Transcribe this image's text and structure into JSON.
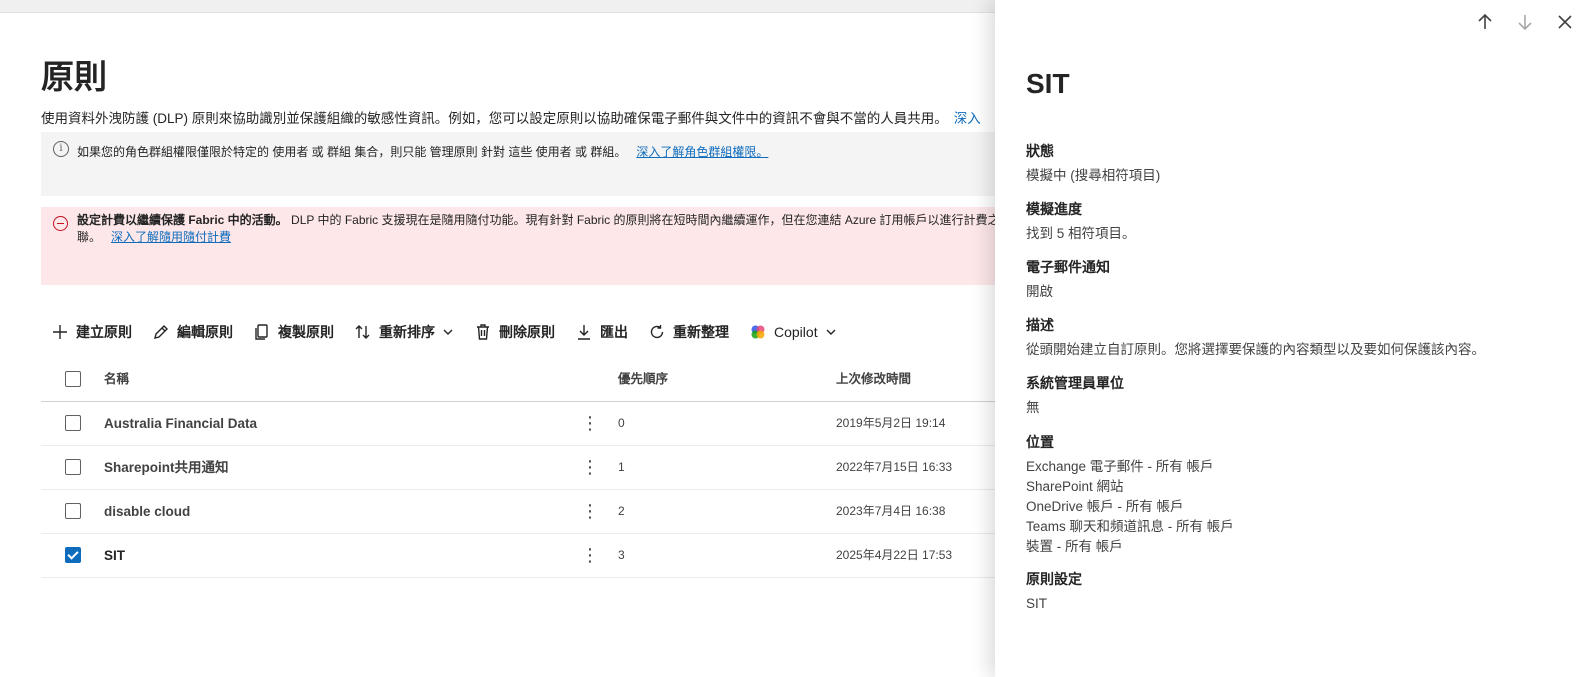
{
  "page": {
    "title": "原則",
    "intro": "使用資料外洩防護 (DLP) 原則來協助識別並保護組織的敏感性資訊。例如，您可以設定原則以協助確保電子郵件與文件中的資訊不會與不當的人員共用。",
    "intro_link": "深入"
  },
  "info_banner": {
    "text": "如果您的角色群組權限僅限於特定的 使用者 或 群組 集合，則只能 管理原則 針對 這些 使用者 或 群組。",
    "link": "深入了解角色群組權限。"
  },
  "error_banner": {
    "title": "設定計費以繼續保護 Fabric 中的活動。",
    "text": "DLP 中的 Fabric 支援現在是隨用隨付功能。現有針對 Fabric 的原則將在短時間內繼續運作，但在您連結 Azure 訂用帳戶以進行計費之前",
    "line2": "聯。",
    "link": "深入了解隨用隨付計費"
  },
  "toolbar": {
    "create": "建立原則",
    "edit": "編輯原則",
    "copy": "複製原則",
    "reorder": "重新排序",
    "delete": "刪除原則",
    "export": "匯出",
    "refresh": "重新整理",
    "copilot": "Copilot"
  },
  "table": {
    "headers": {
      "name": "名稱",
      "priority": "優先順序",
      "modified": "上次修改時間"
    },
    "rows": [
      {
        "name": "Australia Financial Data",
        "priority": "0",
        "modified": "2019年5月2日 19:14",
        "selected": false
      },
      {
        "name": "Sharepoint共用通知",
        "priority": "1",
        "modified": "2022年7月15日 16:33",
        "selected": false
      },
      {
        "name": "disable cloud",
        "priority": "2",
        "modified": "2023年7月4日 16:38",
        "selected": false
      },
      {
        "name": "SIT",
        "priority": "3",
        "modified": "2025年4月22日 17:53",
        "selected": true
      }
    ]
  },
  "panel": {
    "title": "SIT",
    "status": {
      "label": "狀態",
      "value": "模擬中 (搜尋相符項目)"
    },
    "sim_progress": {
      "label": "模擬進度",
      "value": "找到 5 相符項目。"
    },
    "email_notify": {
      "label": "電子郵件通知",
      "value": "開啟"
    },
    "description": {
      "label": "描述",
      "value": "從頭開始建立自訂原則。您將選擇要保護的內容類型以及要如何保護該內容。"
    },
    "admin_units": {
      "label": "系統管理員單位",
      "value": "無"
    },
    "locations": {
      "label": "位置",
      "items": [
        "Exchange 電子郵件 - 所有 帳戶",
        "SharePoint 網站",
        "OneDrive 帳戶 - 所有 帳戶",
        "Teams 聊天和頻道訊息 - 所有 帳戶",
        "裝置 - 所有 帳戶"
      ]
    },
    "policy_settings": {
      "label": "原則設定",
      "value": "SIT"
    }
  }
}
